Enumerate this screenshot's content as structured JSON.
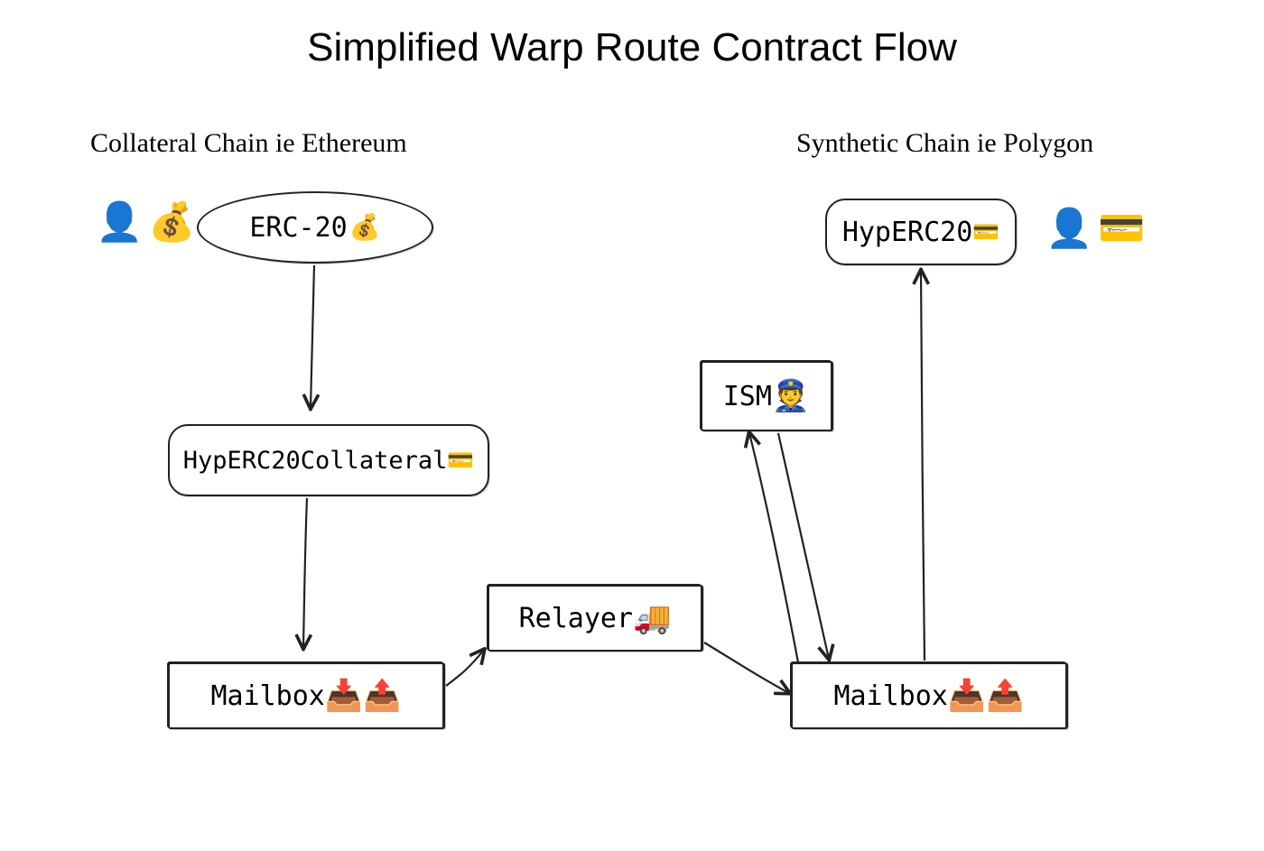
{
  "title": "Simplified Warp Route Contract Flow",
  "labels": {
    "collateral_chain": "Collateral Chain ie Ethereum",
    "synthetic_chain": "Synthetic Chain ie Polygon"
  },
  "nodes": {
    "erc20": "ERC-20",
    "hyp_collateral": "HypERC20Collateral",
    "mailbox_left": "Mailbox",
    "relayer": "Relayer",
    "ism": "ISM",
    "mailbox_right": "Mailbox",
    "hyp_erc20": "HypERC20"
  },
  "icons": {
    "user": "👤",
    "money_bag": "💰",
    "credit_card": "💳",
    "inbox_down": "📥",
    "outbox_up": "📤",
    "truck": "🚚",
    "police": "👮"
  }
}
